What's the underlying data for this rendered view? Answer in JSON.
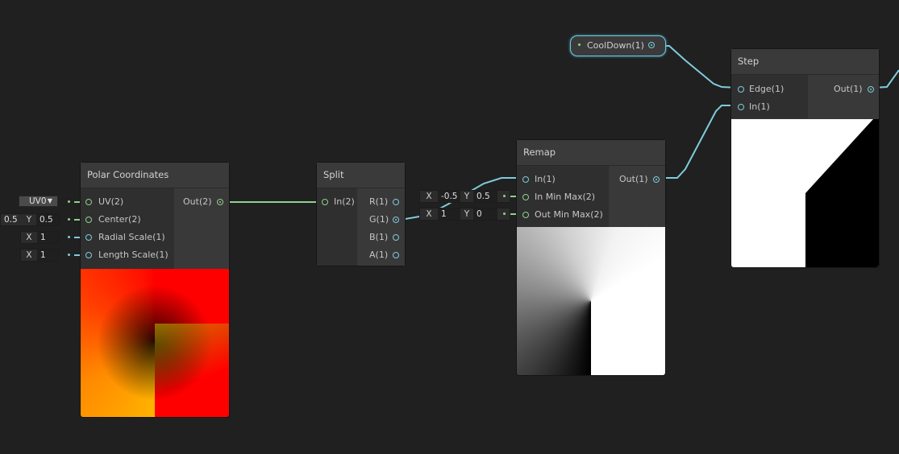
{
  "nodes": {
    "polar": {
      "title": "Polar Coordinates",
      "inputs": [
        {
          "label": "UV(2)"
        },
        {
          "label": "Center(2)"
        },
        {
          "label": "Radial Scale(1)"
        },
        {
          "label": "Length Scale(1)"
        }
      ],
      "output": "Out(2)",
      "uv_dropdown": "UV0",
      "center_x": "0.5",
      "center_y_label": "Y",
      "center_y": "0.5",
      "radial_label": "X",
      "radial_value": "1",
      "length_label": "X",
      "length_value": "1"
    },
    "split": {
      "title": "Split",
      "input": "In(2)",
      "outputs": [
        "R(1)",
        "G(1)",
        "B(1)",
        "A(1)"
      ]
    },
    "remap": {
      "title": "Remap",
      "inputs": [
        "In(1)",
        "In Min Max(2)",
        "Out Min Max(2)"
      ],
      "output": "Out(1)",
      "in_min_max": {
        "x_label": "X",
        "x": "-0.5",
        "y_label": "Y",
        "y": "0.5"
      },
      "out_min_max": {
        "x_label": "X",
        "x": "1",
        "y_label": "Y",
        "y": "0"
      }
    },
    "step": {
      "title": "Step",
      "inputs": [
        "Edge(1)",
        "In(1)"
      ],
      "output": "Out(1)"
    },
    "cooldown": {
      "label": "CoolDown(1)"
    }
  },
  "colors": {
    "background": "#202020",
    "vector2_wire": "#8fd18f",
    "float_wire": "#7fcbdc"
  }
}
